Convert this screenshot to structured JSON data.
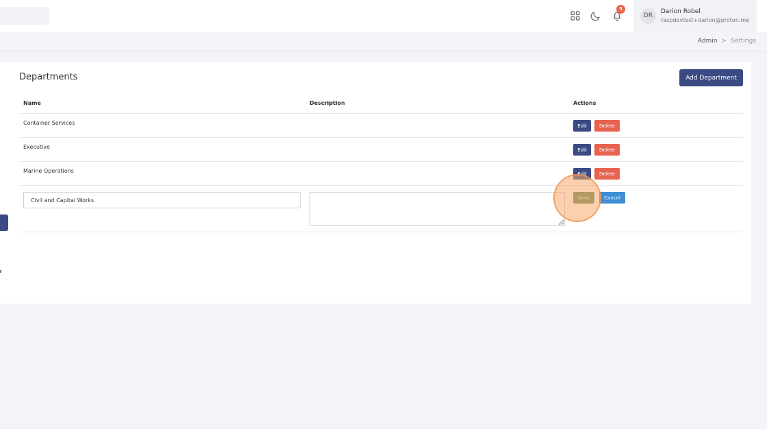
{
  "header": {
    "notifications_count": "5",
    "icons": {
      "apps": "apps-grid-icon",
      "theme": "moon-icon",
      "notifications": "bell-icon"
    },
    "user": {
      "initials": "DR",
      "name": "Darion Robel",
      "email": "raspdevtest+darion@proton.me"
    }
  },
  "breadcrumb": {
    "parent": "Admin",
    "separator": ">",
    "current": "Settings"
  },
  "departments": {
    "title": "Departments",
    "add_button": "Add Department",
    "columns": {
      "name": "Name",
      "description": "Description",
      "actions": "Actions"
    },
    "rows": [
      {
        "name": "Container Services",
        "edit": "Edit",
        "delete": "Delete"
      },
      {
        "name": "Executive",
        "edit": "Edit",
        "delete": "Delete"
      },
      {
        "name": "Marine Operations",
        "edit": "Edit",
        "delete": "Delete"
      }
    ],
    "new_row": {
      "name_value": "Civil and Capital Works",
      "description_value": "",
      "save": "Save",
      "cancel": "Cancel"
    }
  },
  "colors": {
    "primary": "#3b4a82",
    "danger": "#e8634f",
    "success": "#5f8a58",
    "info": "#3d8ed6",
    "highlight": "#f5aa6e"
  }
}
